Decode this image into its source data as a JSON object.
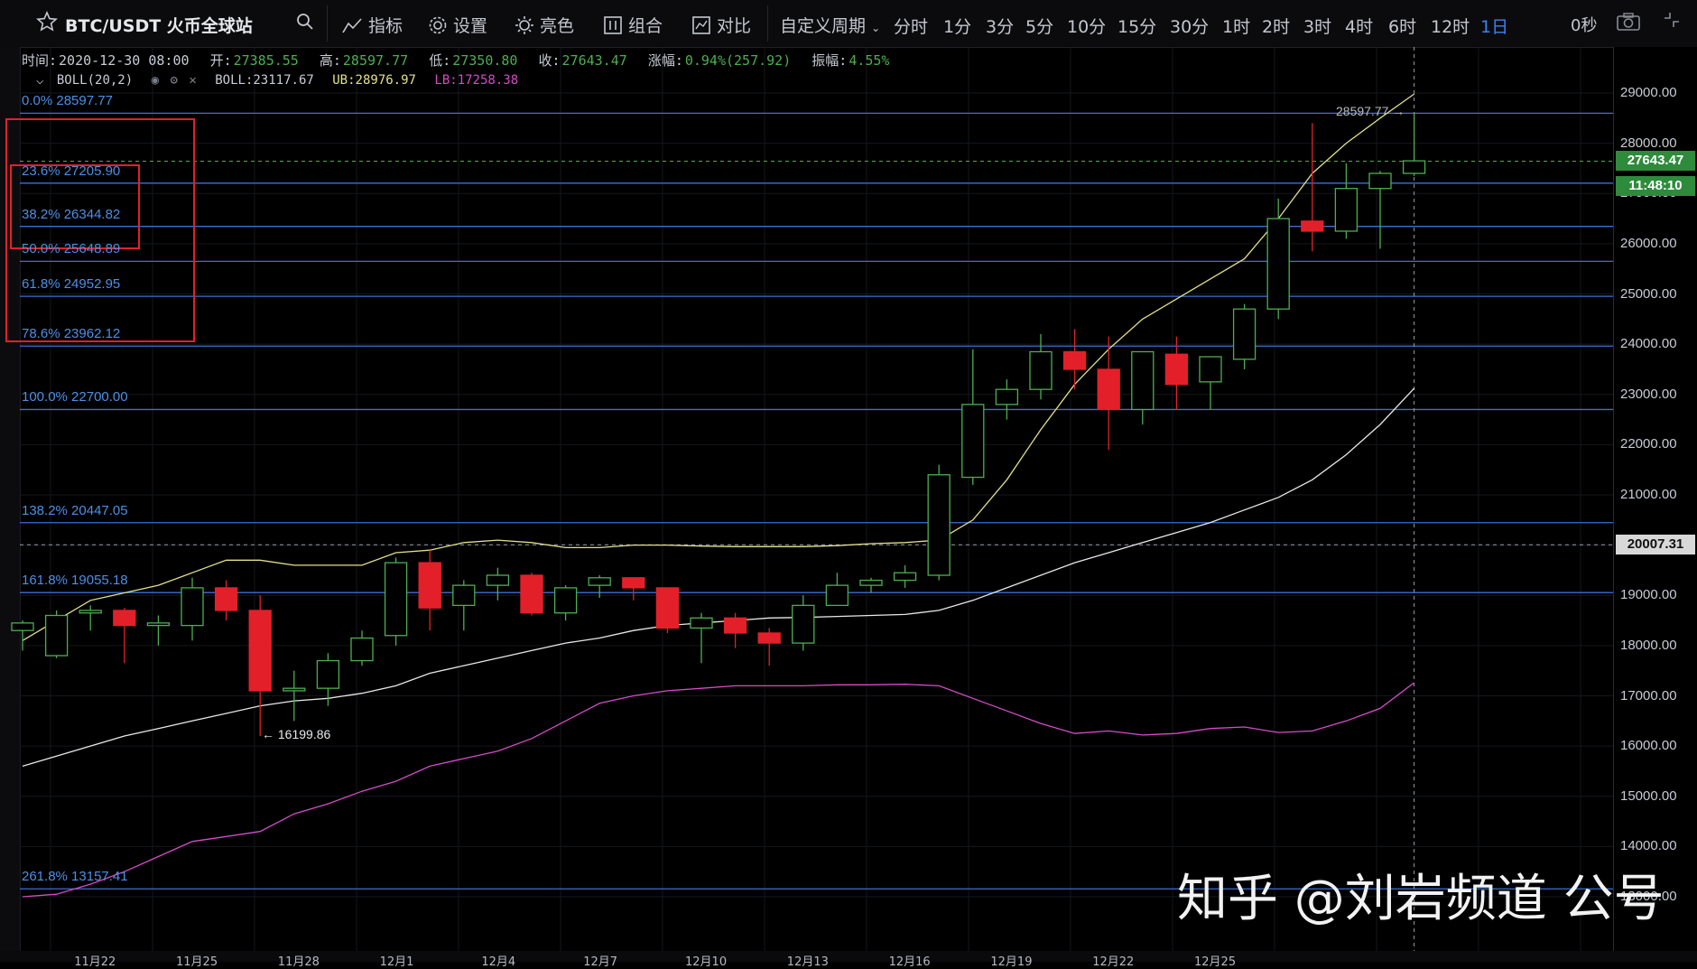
{
  "toolbar": {
    "symbol": "BTC/USDT 火币全球站",
    "indicators": "指标",
    "settings": "设置",
    "theme": "亮色",
    "combine": "组合",
    "compare": "对比",
    "custom_period": "自定义周期",
    "periods": [
      "分时",
      "1分",
      "3分",
      "5分",
      "10分",
      "15分",
      "30分",
      "1时",
      "2时",
      "3时",
      "4时",
      "6时",
      "12时",
      "1日"
    ],
    "active_period": "1日",
    "seconds": "0秒"
  },
  "ohlc": {
    "time_label": "时间:",
    "time": "2020-12-30 08:00",
    "open_label": "开:",
    "open": "27385.55",
    "high_label": "高:",
    "high": "28597.77",
    "low_label": "低:",
    "low": "27350.80",
    "close_label": "收:",
    "close": "27643.47",
    "change_label": "涨幅:",
    "change": "0.94%(257.92)",
    "amp_label": "振幅:",
    "amp": "4.55%"
  },
  "boll": {
    "name": "BOLL(20,2)",
    "mid": "BOLL:23117.67",
    "ub": "UB:28976.97",
    "lb": "LB:17258.38"
  },
  "fib_levels": [
    {
      "label": "0.0% 28597.77",
      "price": 28597.77
    },
    {
      "label": "23.6% 27205.90",
      "price": 27205.9
    },
    {
      "label": "38.2% 26344.82",
      "price": 26344.82
    },
    {
      "label": "50.0% 25648.89",
      "price": 25648.89
    },
    {
      "label": "61.8% 24952.95",
      "price": 24952.95
    },
    {
      "label": "78.6% 23962.12",
      "price": 23962.12
    },
    {
      "label": "100.0% 22700.00",
      "price": 22700.0
    },
    {
      "label": "138.2% 20447.05",
      "price": 20447.05
    },
    {
      "label": "161.8% 19055.18",
      "price": 19055.18
    },
    {
      "label": "261.8% 13157.41",
      "price": 13157.41
    }
  ],
  "price_axis": [
    "29000.00",
    "28000.00",
    "27000.00",
    "26000.00",
    "25000.00",
    "24000.00",
    "23000.00",
    "22000.00",
    "21000.00",
    "20000.00",
    "19000.00",
    "18000.00",
    "17000.00",
    "16000.00",
    "15000.00",
    "14000.00",
    "13000.00"
  ],
  "last_price": "27643.47",
  "countdown": "11:48:10",
  "crosshair_price": "20007.31",
  "high_marker": "28597.77",
  "low_marker": "← 16199.86",
  "date_labels": [
    "11月22",
    "11月25",
    "11月28",
    "12月1",
    "12月4",
    "12月7",
    "12月10",
    "12月13",
    "12月16",
    "12月19",
    "12月22",
    "12月25"
  ],
  "watermark": "知乎 @刘岩频道 公号",
  "colors": {
    "up": "#4caf50",
    "down": "#e3202a",
    "fib": "#3d6fd6",
    "boll_mid": "#e8e8e8",
    "boll_up": "#e3e08a",
    "boll_lb": "#d64bc8",
    "highlight_box": "#e3202a"
  },
  "chart_data": {
    "type": "candlestick",
    "y_range": [
      12900,
      29400
    ],
    "candles": [
      {
        "o": 18300,
        "h": 18500,
        "l": 17900,
        "c": 18450
      },
      {
        "o": 17800,
        "h": 18700,
        "l": 17750,
        "c": 18600
      },
      {
        "o": 18650,
        "h": 18800,
        "l": 18300,
        "c": 18700
      },
      {
        "o": 18700,
        "h": 18750,
        "l": 17650,
        "c": 18400
      },
      {
        "o": 18400,
        "h": 18600,
        "l": 18000,
        "c": 18450
      },
      {
        "o": 18400,
        "h": 19350,
        "l": 18100,
        "c": 19150
      },
      {
        "o": 19150,
        "h": 19300,
        "l": 18500,
        "c": 18700
      },
      {
        "o": 18700,
        "h": 19000,
        "l": 16200,
        "c": 17100
      },
      {
        "o": 17100,
        "h": 17500,
        "l": 16500,
        "c": 17150
      },
      {
        "o": 17150,
        "h": 17850,
        "l": 16800,
        "c": 17700
      },
      {
        "o": 17700,
        "h": 18300,
        "l": 17600,
        "c": 18150
      },
      {
        "o": 18200,
        "h": 19750,
        "l": 18000,
        "c": 19650
      },
      {
        "o": 19650,
        "h": 19900,
        "l": 18300,
        "c": 18750
      },
      {
        "o": 18800,
        "h": 19300,
        "l": 18300,
        "c": 19200
      },
      {
        "o": 19200,
        "h": 19550,
        "l": 18900,
        "c": 19400
      },
      {
        "o": 19400,
        "h": 19450,
        "l": 18600,
        "c": 18650
      },
      {
        "o": 18650,
        "h": 19200,
        "l": 18500,
        "c": 19150
      },
      {
        "o": 19200,
        "h": 19400,
        "l": 18950,
        "c": 19350
      },
      {
        "o": 19350,
        "h": 19300,
        "l": 18900,
        "c": 19150
      },
      {
        "o": 19150,
        "h": 19150,
        "l": 18250,
        "c": 18350
      },
      {
        "o": 18350,
        "h": 18650,
        "l": 17650,
        "c": 18550
      },
      {
        "o": 18550,
        "h": 18650,
        "l": 17950,
        "c": 18250
      },
      {
        "o": 18250,
        "h": 18350,
        "l": 17600,
        "c": 18050
      },
      {
        "o": 18050,
        "h": 19000,
        "l": 17900,
        "c": 18800
      },
      {
        "o": 18800,
        "h": 19450,
        "l": 18800,
        "c": 19200
      },
      {
        "o": 19200,
        "h": 19350,
        "l": 19050,
        "c": 19300
      },
      {
        "o": 19300,
        "h": 19600,
        "l": 19150,
        "c": 19450
      },
      {
        "o": 19400,
        "h": 21600,
        "l": 19300,
        "c": 21400
      },
      {
        "o": 21350,
        "h": 23900,
        "l": 21200,
        "c": 22800
      },
      {
        "o": 22800,
        "h": 23300,
        "l": 22500,
        "c": 23100
      },
      {
        "o": 23100,
        "h": 24200,
        "l": 22900,
        "c": 23850
      },
      {
        "o": 23850,
        "h": 24300,
        "l": 23100,
        "c": 23500
      },
      {
        "o": 23500,
        "h": 24150,
        "l": 21900,
        "c": 22700
      },
      {
        "o": 22700,
        "h": 23850,
        "l": 22400,
        "c": 23850
      },
      {
        "o": 23800,
        "h": 24150,
        "l": 22700,
        "c": 23200
      },
      {
        "o": 23250,
        "h": 23750,
        "l": 22700,
        "c": 23750
      },
      {
        "o": 23700,
        "h": 24800,
        "l": 23500,
        "c": 24700
      },
      {
        "o": 24700,
        "h": 26900,
        "l": 24500,
        "c": 26500
      },
      {
        "o": 26450,
        "h": 28400,
        "l": 25850,
        "c": 26250
      },
      {
        "o": 26250,
        "h": 27600,
        "l": 26100,
        "c": 27100
      },
      {
        "o": 27100,
        "h": 27450,
        "l": 25900,
        "c": 27400
      },
      {
        "o": 27400,
        "h": 28600,
        "l": 27350,
        "c": 27650
      }
    ],
    "boll_upper": [
      18100,
      18500,
      18900,
      19050,
      19200,
      19450,
      19700,
      19700,
      19600,
      19600,
      19600,
      19850,
      19900,
      20050,
      20100,
      20050,
      19950,
      19950,
      20000,
      20000,
      19980,
      19970,
      19970,
      19970,
      19990,
      20030,
      20050,
      20100,
      20500,
      21300,
      22300,
      23200,
      23900,
      24500,
      24900,
      25300,
      25700,
      26500,
      27400,
      28000,
      28500,
      28980
    ],
    "boll_mid": [
      15600,
      15800,
      16000,
      16200,
      16350,
      16500,
      16650,
      16800,
      16900,
      16950,
      17050,
      17200,
      17450,
      17600,
      17750,
      17900,
      18050,
      18150,
      18300,
      18400,
      18450,
      18500,
      18550,
      18560,
      18580,
      18600,
      18620,
      18700,
      18900,
      19150,
      19400,
      19650,
      19850,
      20050,
      20250,
      20450,
      20700,
      20950,
      21300,
      21800,
      22400,
      23120
    ],
    "boll_lower": [
      13000,
      13050,
      13250,
      13500,
      13800,
      14100,
      14200,
      14300,
      14650,
      14850,
      15100,
      15300,
      15600,
      15750,
      15900,
      16150,
      16500,
      16850,
      17000,
      17100,
      17150,
      17200,
      17200,
      17200,
      17220,
      17220,
      17230,
      17200,
      16950,
      16700,
      16450,
      16250,
      16300,
      16220,
      16250,
      16350,
      16380,
      16270,
      16300,
      16500,
      16750,
      17260
    ]
  }
}
